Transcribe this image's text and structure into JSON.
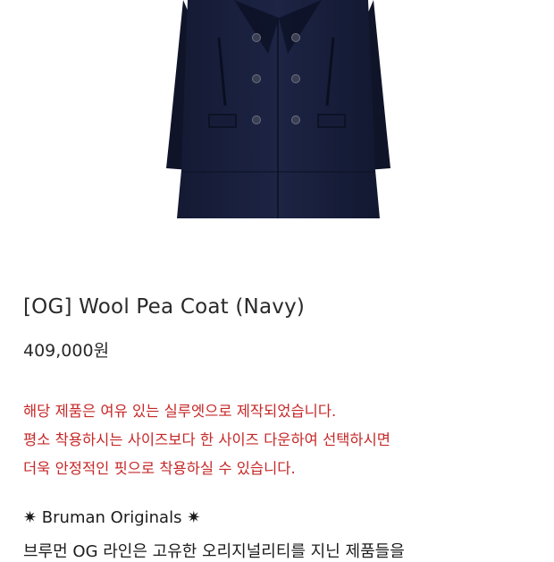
{
  "product": {
    "image_alt": "Wool Pea Coat (Navy) product photo",
    "title": "[OG] Wool Pea Coat (Navy)",
    "price": "409,000원"
  },
  "notice": {
    "lines": [
      "해당 제품은 여유 있는 실루엣으로 제작되었습니다.",
      "평소 착용하시는 사이즈보다 한 사이즈 다운하여 선택하시면",
      "더욱 안정적인 핏으로 착용하실 수 있습니다."
    ],
    "color": "#c62828"
  },
  "description": {
    "heading": "✷ Bruman Originals ✷",
    "line1": "브루먼 OG 라인은 고유한 오리지널리티를 지닌 제품들을"
  }
}
